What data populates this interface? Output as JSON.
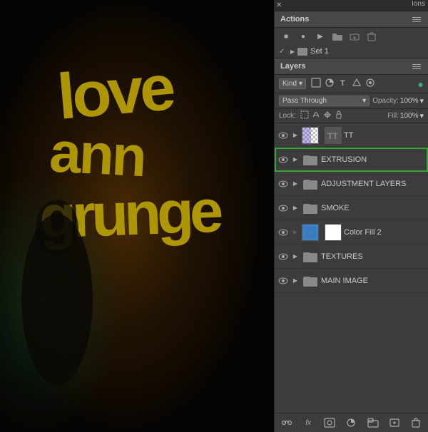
{
  "panel": {
    "close_symbol": "✕",
    "ions_label": "Ions"
  },
  "actions": {
    "title": "Actions",
    "menu_title": "≡",
    "toolbar": {
      "stop": "■",
      "record": "●",
      "play": "▶",
      "folder": "📁",
      "new": "✦",
      "delete": "🗑"
    },
    "set": {
      "check": "✓",
      "triangle": "▶",
      "label": "Set 1"
    }
  },
  "layers": {
    "title": "Layers",
    "menu_title": "≡",
    "filter": {
      "kind_label": "Kind",
      "dropdown_arrow": "▾",
      "icons": [
        "🔳",
        "✏",
        "T",
        "A",
        "⚙"
      ]
    },
    "blend_mode": {
      "value": "Pass Through",
      "arrow": "▾",
      "opacity_label": "Opacity:",
      "opacity_value": "100%",
      "opacity_arrow": "▾"
    },
    "lock": {
      "label": "Lock:",
      "icons": [
        "⛶",
        "✛",
        "🖌",
        "🔒"
      ],
      "fill_label": "Fill:",
      "fill_value": "100%",
      "fill_arrow": "▾"
    },
    "items": [
      {
        "id": "tt",
        "name": "TT",
        "type": "group",
        "visible": true,
        "expanded": false,
        "thumbnail_type": "tt",
        "highlighted": false,
        "active": false
      },
      {
        "id": "extrusion",
        "name": "EXTRUSION",
        "type": "group",
        "visible": true,
        "expanded": false,
        "thumbnail_type": "folder",
        "highlighted": true,
        "active": false
      },
      {
        "id": "adjustment-layers",
        "name": "ADJUSTMENT LAYERS",
        "type": "group",
        "visible": true,
        "expanded": false,
        "thumbnail_type": "folder",
        "highlighted": false,
        "active": false
      },
      {
        "id": "smoke",
        "name": "SMOKE",
        "type": "group",
        "visible": true,
        "expanded": false,
        "thumbnail_type": "folder",
        "highlighted": false,
        "active": false
      },
      {
        "id": "color-fill-2",
        "name": "Color Fill 2",
        "type": "fill",
        "visible": true,
        "expanded": false,
        "thumbnail_type": "colorfill",
        "highlighted": false,
        "active": false
      },
      {
        "id": "textures",
        "name": "TEXTURES",
        "type": "group",
        "visible": true,
        "expanded": false,
        "thumbnail_type": "folder",
        "highlighted": false,
        "active": false
      },
      {
        "id": "main-image",
        "name": "MAIN IMAGE",
        "type": "group",
        "visible": true,
        "expanded": false,
        "thumbnail_type": "folder",
        "highlighted": false,
        "active": false
      }
    ],
    "bottom": {
      "link": "⛓",
      "fx": "fx",
      "mask": "⬜",
      "adjustment": "◑",
      "folder": "📁",
      "new": "📄",
      "delete": "🗑"
    }
  }
}
